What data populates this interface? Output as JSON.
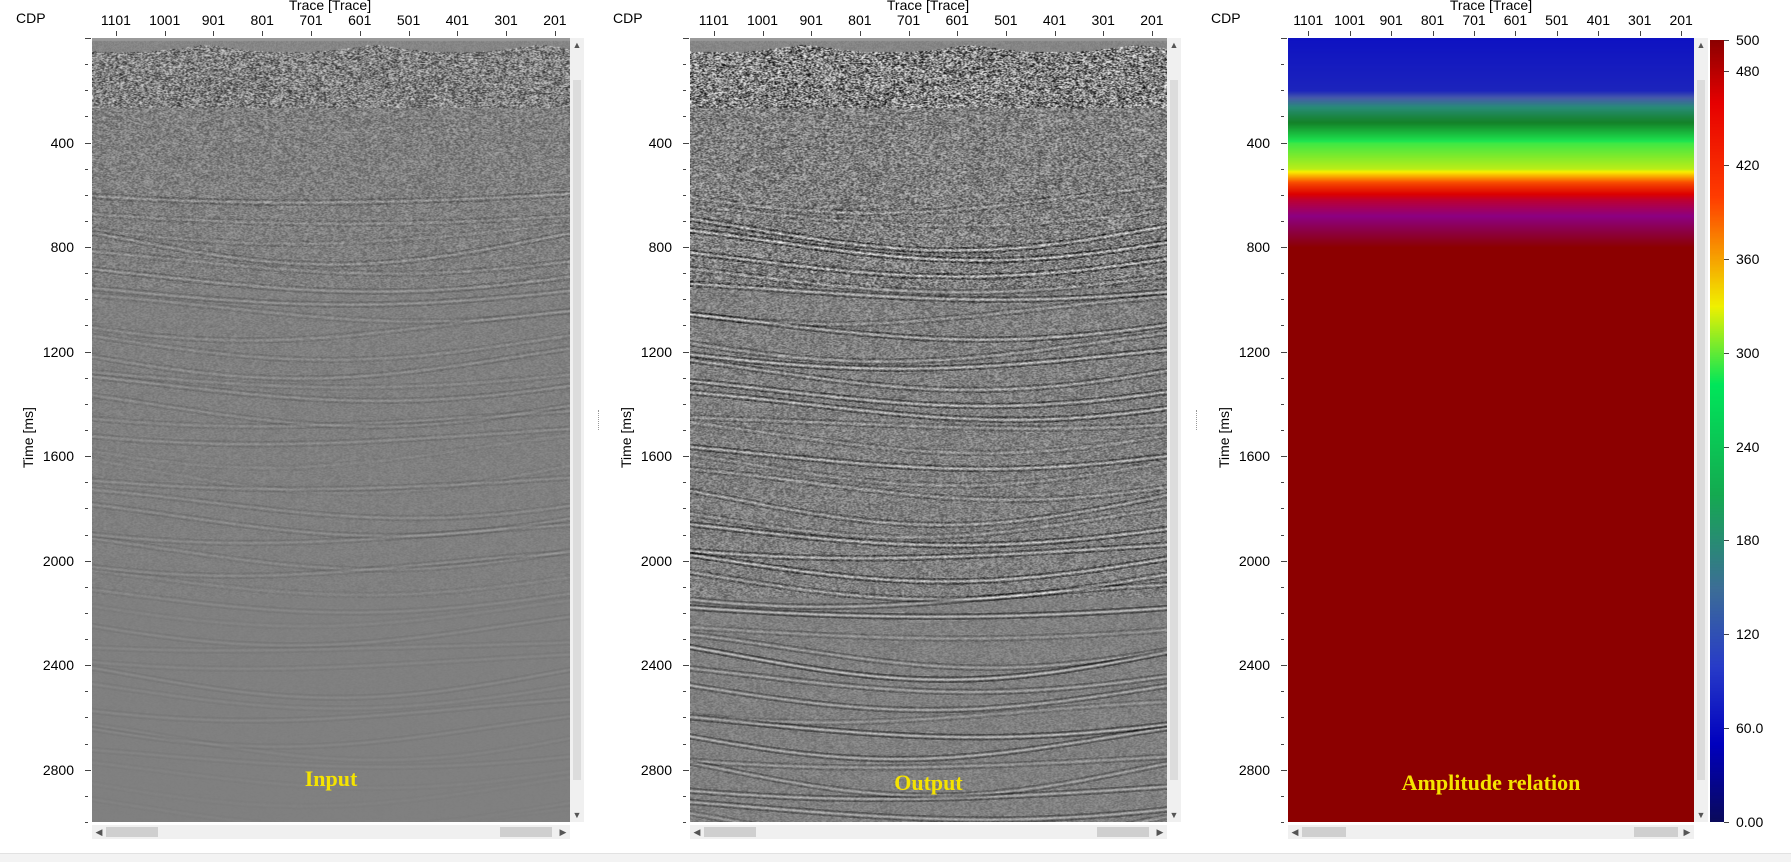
{
  "axes": {
    "cdp_label": "CDP",
    "x_title": "Trace [Trace]",
    "y_title": "Time [ms]",
    "x_ticks": [
      "1101",
      "1001",
      "901",
      "801",
      "701",
      "601",
      "501",
      "401",
      "301",
      "201"
    ],
    "y_ticks": [
      "400",
      "800",
      "1200",
      "1600",
      "2000",
      "2400",
      "2800"
    ]
  },
  "panels": [
    {
      "label": "Input"
    },
    {
      "label": "Output"
    },
    {
      "label": "Amplitude relation"
    }
  ],
  "colorbar": {
    "ticks": [
      "500",
      "480",
      "420",
      "360",
      "300",
      "240",
      "180",
      "120",
      "60.0",
      "0.00"
    ]
  },
  "chart_data": [
    {
      "type": "heatmap",
      "title": "Input",
      "xlabel": "Trace [Trace]",
      "ylabel": "Time [ms]",
      "x_ticks": [
        1101,
        1001,
        901,
        801,
        701,
        601,
        501,
        401,
        301,
        201
      ],
      "y_ticks": [
        400,
        800,
        1200,
        1600,
        2000,
        2400,
        2800
      ],
      "xlim": [
        1150,
        170
      ],
      "ylim": [
        0,
        3000
      ],
      "colormap": "grayscale"
    },
    {
      "type": "heatmap",
      "title": "Output",
      "xlabel": "Trace [Trace]",
      "ylabel": "Time [ms]",
      "x_ticks": [
        1101,
        1001,
        901,
        801,
        701,
        601,
        501,
        401,
        301,
        201
      ],
      "y_ticks": [
        400,
        800,
        1200,
        1600,
        2000,
        2400,
        2800
      ],
      "xlim": [
        1150,
        170
      ],
      "ylim": [
        0,
        3000
      ],
      "colormap": "grayscale"
    },
    {
      "type": "heatmap",
      "title": "Amplitude relation",
      "xlabel": "Trace [Trace]",
      "ylabel": "Time [ms]",
      "x_ticks": [
        1101,
        1001,
        901,
        801,
        701,
        601,
        501,
        401,
        301,
        201
      ],
      "y_ticks": [
        400,
        800,
        1200,
        1600,
        2000,
        2400,
        2800
      ],
      "xlim": [
        1150,
        170
      ],
      "ylim": [
        0,
        3000
      ],
      "colorbar_range": [
        0,
        500
      ],
      "colorbar_ticks": [
        500,
        480,
        420,
        360,
        300,
        240,
        180,
        120,
        60,
        0
      ],
      "profile_time_ms": [
        0,
        200,
        300,
        400,
        500,
        560,
        620,
        720,
        800,
        3000
      ],
      "profile_value": [
        70,
        80,
        190,
        280,
        300,
        360,
        410,
        460,
        500,
        500
      ]
    }
  ]
}
